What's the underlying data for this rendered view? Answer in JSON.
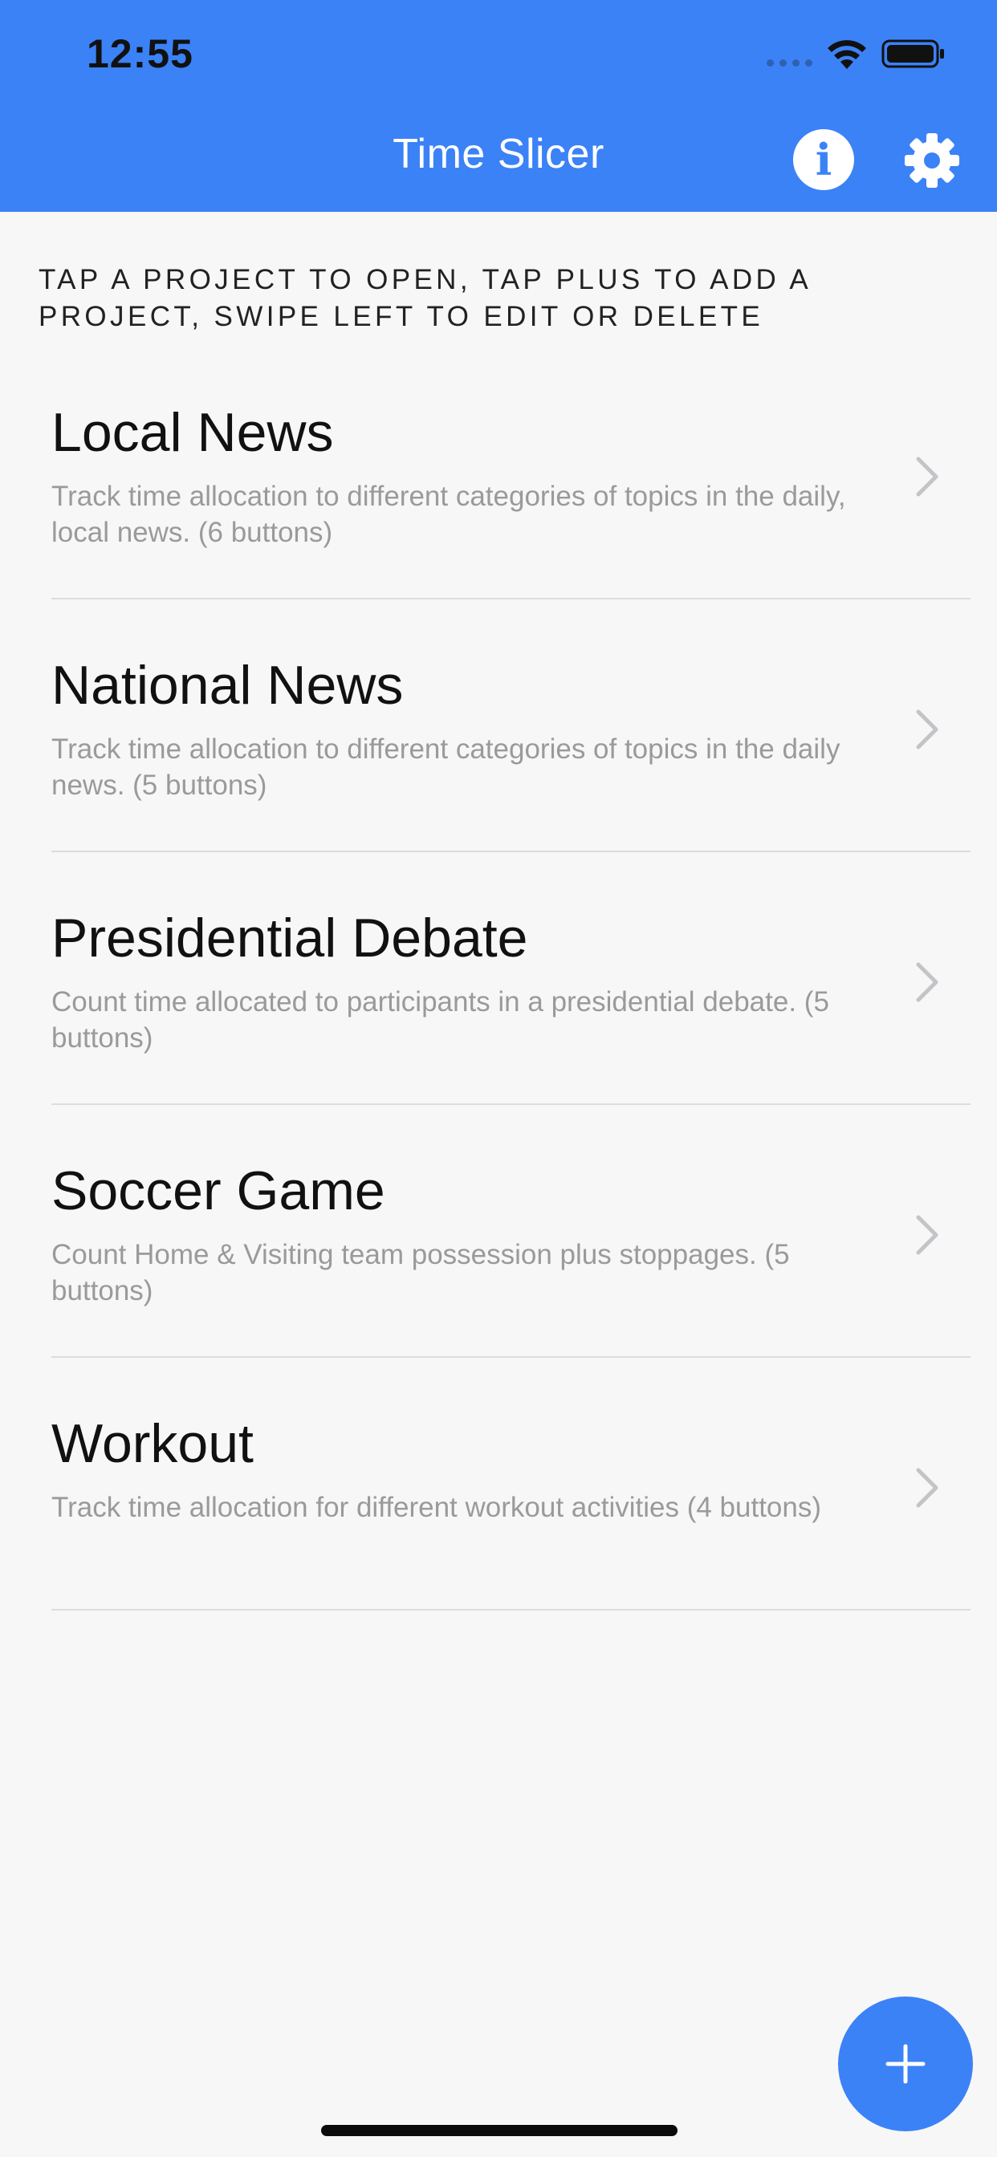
{
  "status_bar": {
    "time": "12:55",
    "icons": [
      "signal-icon",
      "wifi-icon",
      "battery-icon"
    ]
  },
  "header": {
    "title": "Time Slicer",
    "info_icon": "info-icon",
    "info_glyph": "i",
    "settings_icon": "gear-icon"
  },
  "instructions": "TAP A PROJECT TO OPEN, TAP PLUS TO ADD A PROJECT, SWIPE LEFT TO EDIT OR DELETE",
  "projects": [
    {
      "title": "Local News",
      "description": "Track time allocation to different categories of topics in the daily, local news. (6 buttons)"
    },
    {
      "title": "National News",
      "description": "Track time allocation to different categories of topics in the daily news. (5 buttons)"
    },
    {
      "title": "Presidential Debate",
      "description": "Count time allocated to participants in a presidential debate. (5 buttons)"
    },
    {
      "title": "Soccer Game",
      "description": "Count Home & Visiting team possession plus stoppages. (5 buttons)"
    },
    {
      "title": "Workout",
      "description": "Track time allocation for different workout activities (4 buttons)"
    }
  ],
  "fab": {
    "icon": "plus-icon"
  },
  "colors": {
    "accent": "#3b82f6",
    "background": "#f7f7f7",
    "subtitle": "#9a9a9a"
  }
}
